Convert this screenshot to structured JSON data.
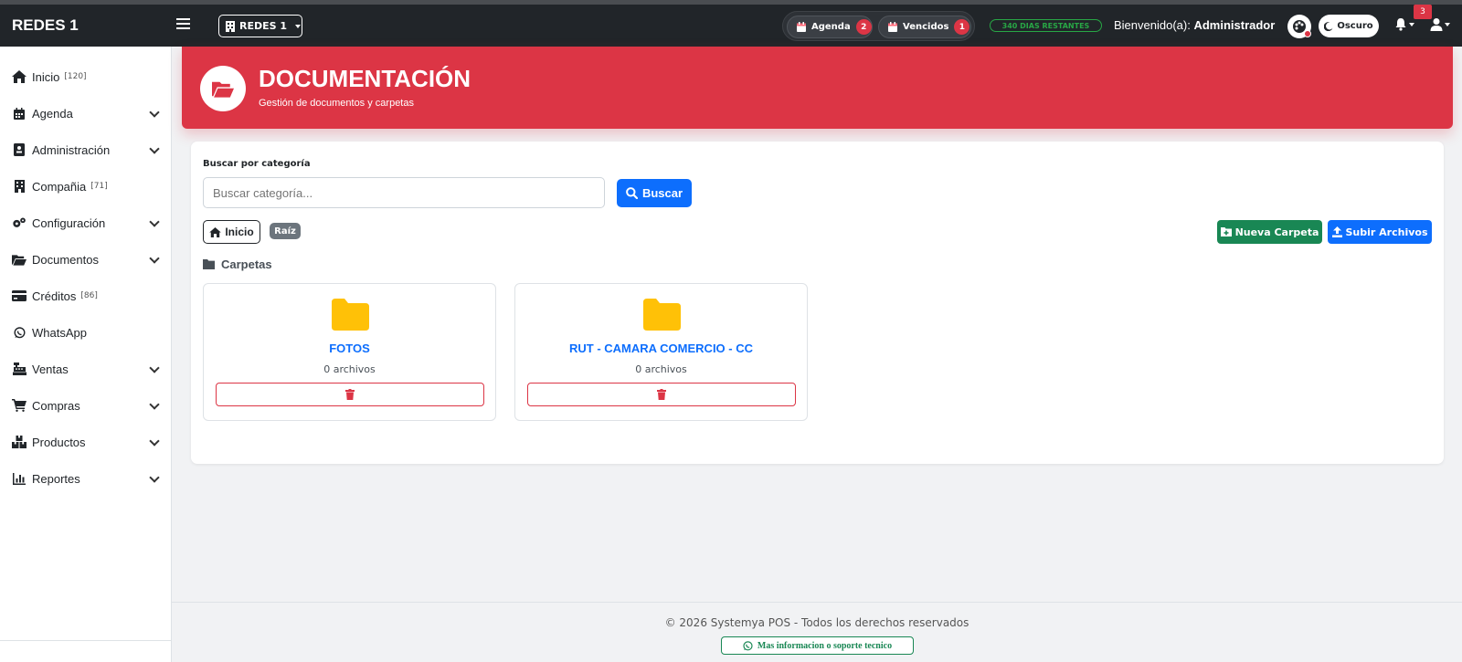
{
  "navbar": {
    "brand": "REDES 1",
    "company_selector": "REDES 1",
    "agenda_label": "Agenda",
    "agenda_count": "2",
    "vencidos_label": "Vencidos",
    "vencidos_count": "1",
    "days_remaining": "340 DIAS RESTANTES",
    "welcome_prefix": "Bienvenido(a):",
    "welcome_user": "Administrador",
    "theme_label": "Oscuro",
    "notifications_count": "3"
  },
  "sidebar": {
    "items": [
      {
        "label": "Inicio",
        "count": "[120]",
        "icon": "home-icon"
      },
      {
        "label": "Agenda",
        "icon": "calendar-icon"
      },
      {
        "label": "Administración",
        "icon": "id-card-icon"
      },
      {
        "label": "Compañia",
        "count": "[71]",
        "icon": "building-icon"
      },
      {
        "label": "Configuración",
        "icon": "gears-icon"
      },
      {
        "label": "Documentos",
        "icon": "folder-open-icon"
      },
      {
        "label": "Créditos",
        "count": "[86]",
        "icon": "credit-card-icon"
      },
      {
        "label": "WhatsApp",
        "icon": "whatsapp-icon"
      },
      {
        "label": "Ventas",
        "icon": "cash-register-icon"
      },
      {
        "label": "Compras",
        "icon": "cart-icon"
      },
      {
        "label": "Productos",
        "icon": "boxes-icon"
      },
      {
        "label": "Reportes",
        "icon": "chart-icon"
      }
    ]
  },
  "header": {
    "title": "DOCUMENTACIÓN",
    "subtitle": "Gestión de documentos y carpetas"
  },
  "search": {
    "label": "Buscar por categoría",
    "placeholder": "Buscar categoría...",
    "button": "Buscar"
  },
  "breadcrumb": {
    "home": "Inicio",
    "root": "Raíz"
  },
  "actions": {
    "new_folder": "Nueva Carpeta",
    "upload": "Subir Archivos"
  },
  "folders_section": {
    "title": "Carpetas",
    "items": [
      {
        "name": "FOTOS",
        "files": "0 archivos"
      },
      {
        "name": "RUT - CAMARA COMERCIO - CC",
        "files": "0 archivos"
      }
    ]
  },
  "footer": {
    "copyright": "© 2026 Systemya POS - Todos los derechos reservados",
    "support": "Mas informacion o soporte tecnico"
  },
  "colors": {
    "navbar": "#212529",
    "accent_red": "#dc3545",
    "primary": "#0d6efd",
    "success": "#198754",
    "folder": "#ffc107"
  }
}
